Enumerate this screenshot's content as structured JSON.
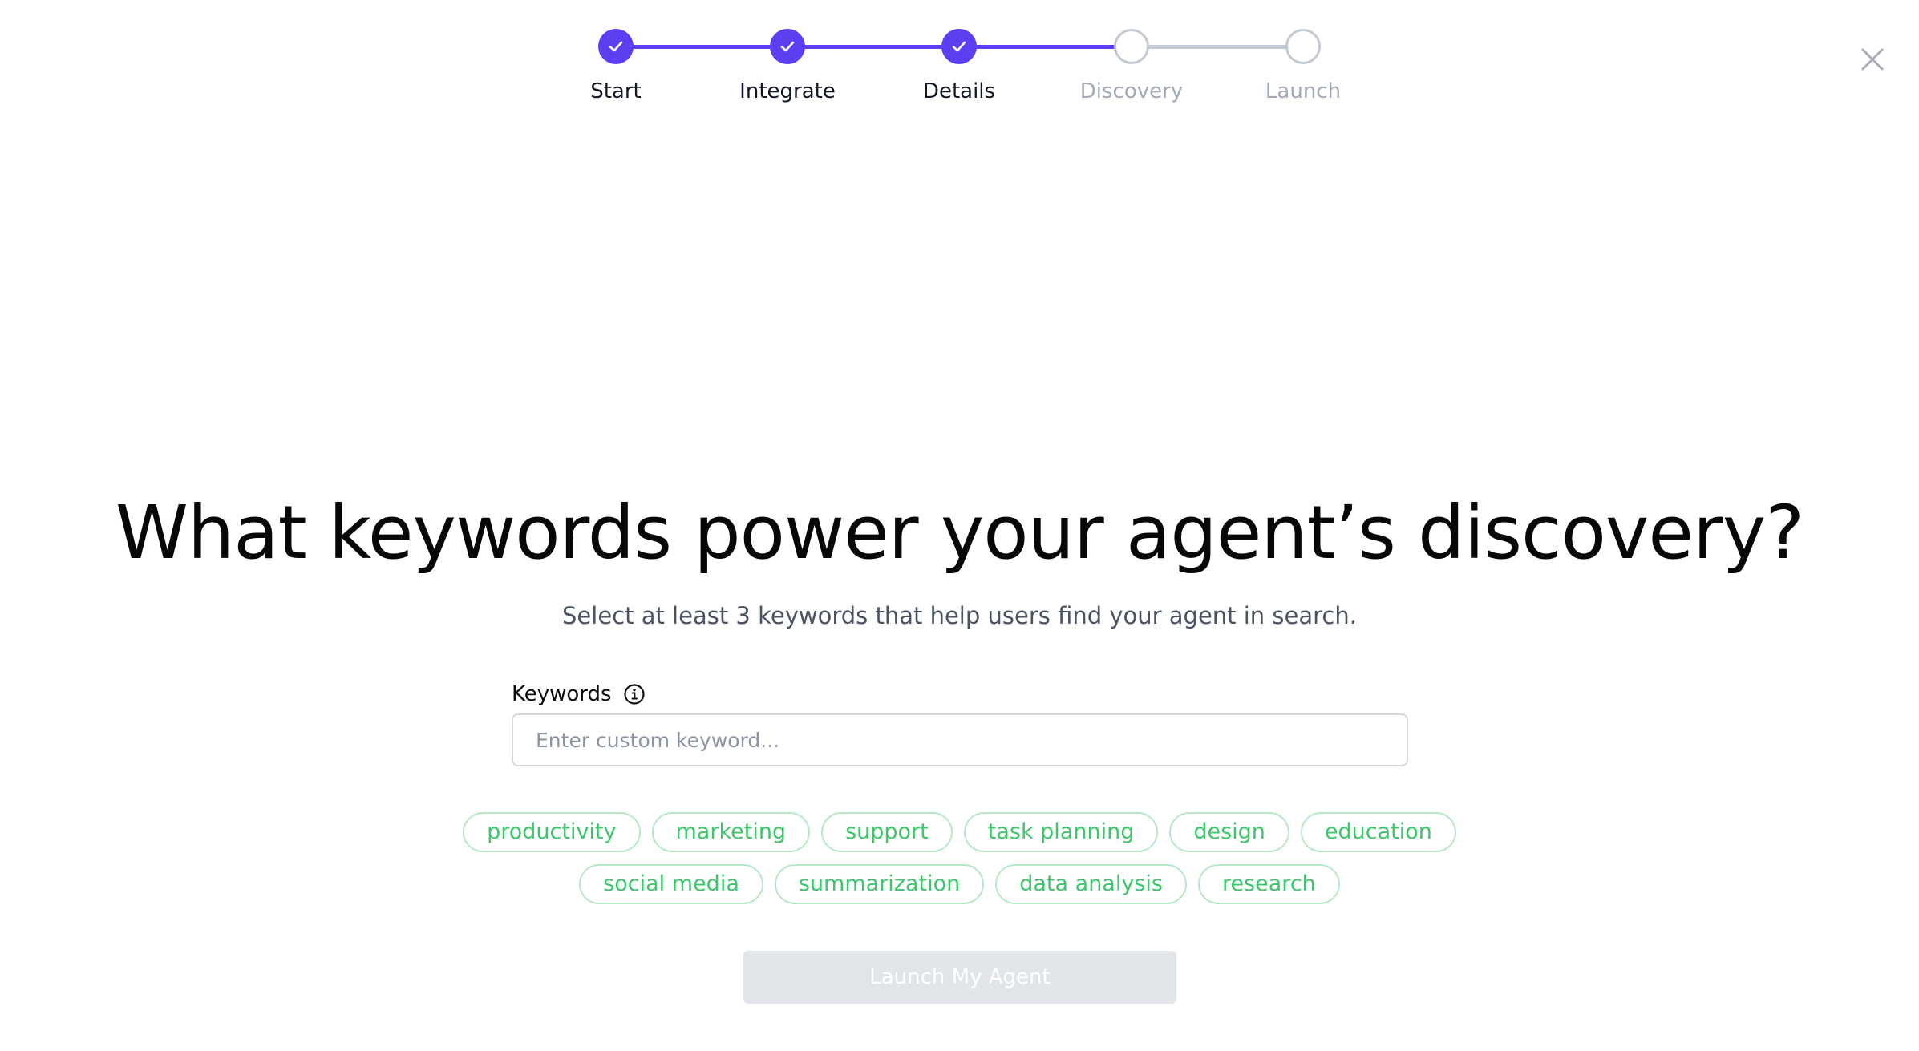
{
  "stepper": {
    "steps": [
      {
        "label": "Start",
        "status": "completed"
      },
      {
        "label": "Integrate",
        "status": "completed"
      },
      {
        "label": "Details",
        "status": "completed"
      },
      {
        "label": "Discovery",
        "status": "pending"
      },
      {
        "label": "Launch",
        "status": "pending"
      }
    ],
    "accent_color": "#5b3ff0",
    "pending_color": "#c3c9d2"
  },
  "close_icon": "close-icon",
  "main": {
    "headline": "What keywords power your agent’s discovery?",
    "subtitle": "Select at least 3 keywords that help users find your agent in search."
  },
  "keywords_field": {
    "label": "Keywords",
    "info_icon": "info-icon",
    "placeholder": "Enter custom keyword...",
    "value": ""
  },
  "suggested_keywords": {
    "row1": [
      "productivity",
      "marketing",
      "support",
      "task planning",
      "design",
      "education"
    ],
    "row2": [
      "social media",
      "summarization",
      "data analysis",
      "research"
    ],
    "chip_color": "#3ec66b"
  },
  "launch_button": {
    "label": "Launch My Agent",
    "disabled": true
  }
}
